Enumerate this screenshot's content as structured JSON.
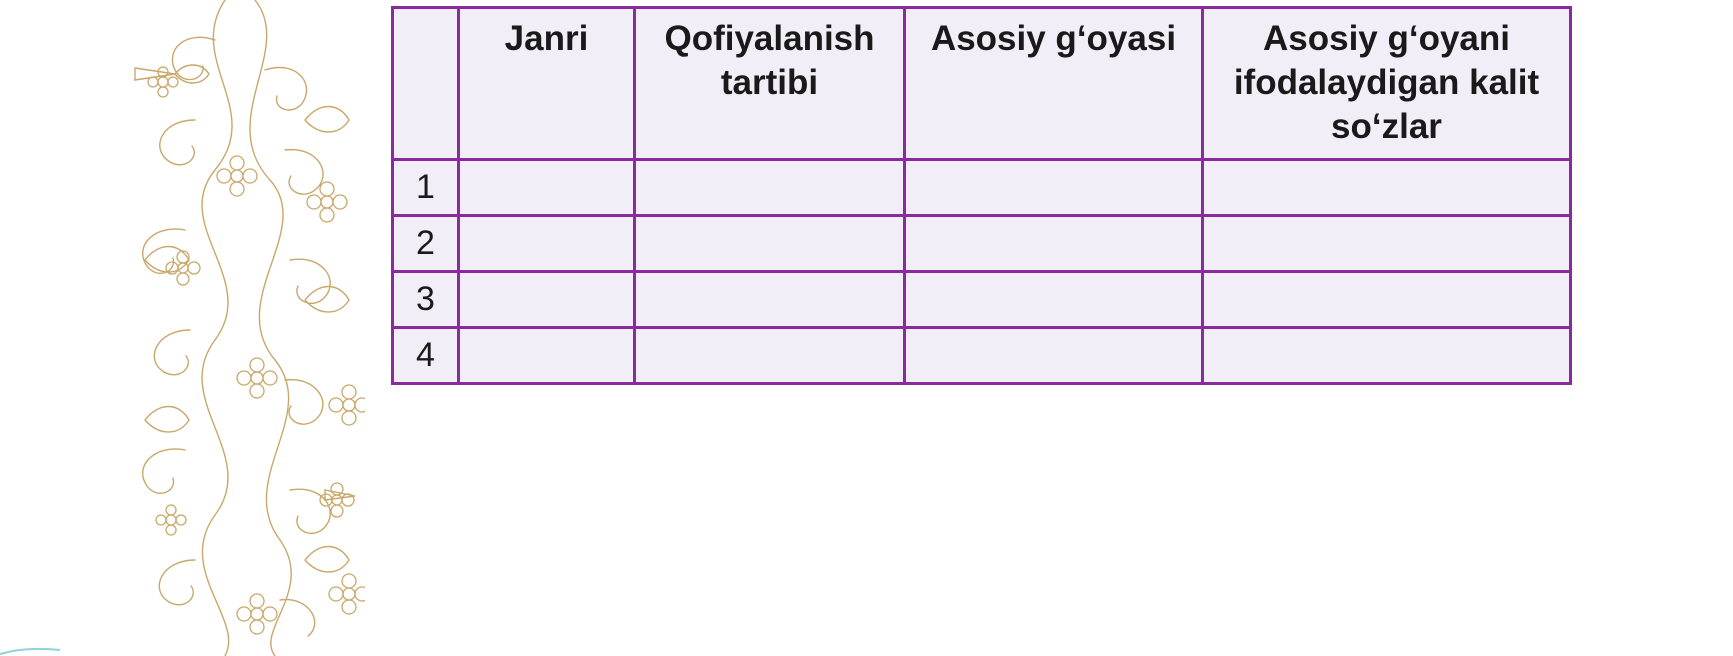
{
  "table": {
    "columns": [
      "",
      "Janri",
      "Qofiyalanish tartibi",
      "Asosiy g‘oyasi",
      "Asosiy g‘oyani ifodalaydigan kalit so‘zlar"
    ],
    "rows": [
      {
        "num": "1",
        "cells": [
          "",
          "",
          "",
          ""
        ]
      },
      {
        "num": "2",
        "cells": [
          "",
          "",
          "",
          ""
        ]
      },
      {
        "num": "3",
        "cells": [
          "",
          "",
          "",
          ""
        ]
      },
      {
        "num": "4",
        "cells": [
          "",
          "",
          "",
          ""
        ]
      }
    ]
  },
  "colors": {
    "border": "#8a2a9e",
    "cell_fill": "#f2eef7",
    "ornament": "#c9a76a"
  },
  "decoration": {
    "left_border": "floral-ornament"
  }
}
